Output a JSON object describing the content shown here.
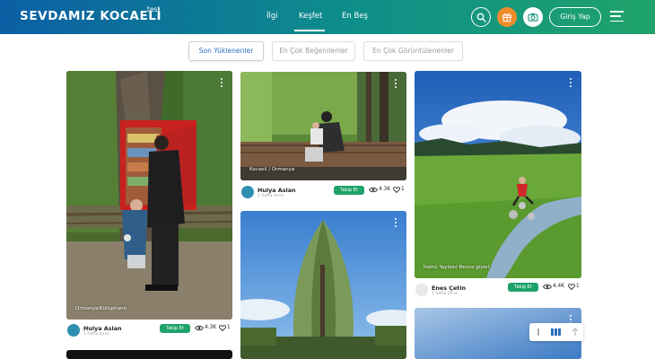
{
  "header": {
    "logo": "SEVDAMIZ KOCAELİ",
    "logo_sup": "test",
    "nav": [
      {
        "label": "İlgi"
      },
      {
        "label": "Keşfet"
      },
      {
        "label": "En Beş"
      }
    ],
    "login_label": "Giriş Yap",
    "colors": {
      "gradient_start": "#0b5fa5",
      "gradient_end": "#1fa36a",
      "gift_button": "#f08c2b"
    }
  },
  "filters": [
    {
      "label": "Son Yüklenenler",
      "active": true
    },
    {
      "label": "En Çok Beğenilenler",
      "active": false
    },
    {
      "label": "En Çok Görüntülenenler",
      "active": false
    }
  ],
  "posts": [
    {
      "caption": "Ormanya/Kütüphane",
      "user": "Hulya Aslan",
      "time": "1 hafta önce",
      "follow": "Takip Et",
      "views": "4.3K",
      "likes": "1"
    },
    {
      "caption": "Kocaeli / Ormanya",
      "user": "Hulya Aslan",
      "time": "1 hafta önce",
      "follow": "Takip Et",
      "views": "4.3K",
      "likes": "1"
    },
    {
      "caption": "İndnü Yaylası/ Bence güzel",
      "user": "Enes Çetin",
      "time": "1 hafta önce",
      "follow": "Takip Et",
      "views": "4.4K",
      "likes": "1"
    }
  ],
  "colors": {
    "follow_button": "#1fa36a",
    "active_filter_text": "#2a6ebd"
  }
}
